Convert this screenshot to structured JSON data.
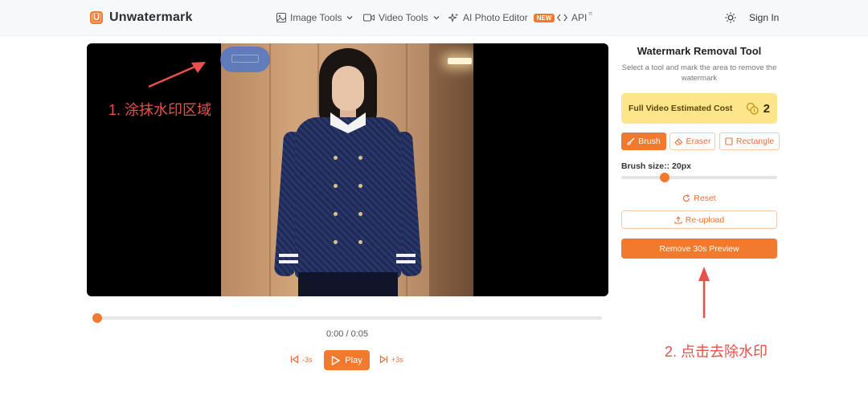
{
  "header": {
    "brand": "Unwatermark",
    "nav": {
      "image_tools": "Image Tools",
      "video_tools": "Video Tools",
      "ai_photo_editor": "AI Photo Editor",
      "new_badge": "NEW",
      "api": "API",
      "api_superscript": "π"
    },
    "sign_in": "Sign In"
  },
  "annotations": {
    "step1": "1. 涂抹水印区域",
    "step2": "2. 点击去除水印"
  },
  "player": {
    "time": "0:00 / 0:05",
    "progress": 0,
    "back_label": "-3s",
    "play_label": "Play",
    "forward_label": "+3s"
  },
  "panel": {
    "title": "Watermark Removal Tool",
    "description": "Select a tool and mark the area to remove the watermark",
    "cost_label": "Full Video Estimated Cost",
    "cost_value": "2",
    "tools": {
      "brush": "Brush",
      "eraser": "Eraser",
      "rectangle": "Rectangle"
    },
    "active_tool": "brush",
    "brush_size_label": "Brush size:: 20px",
    "brush_size_fraction": 0.28,
    "reset": "Reset",
    "reupload": "Re-upload",
    "remove": "Remove 30s Preview"
  },
  "colors": {
    "accent": "#f17a2f",
    "annotation": "#e8504b",
    "cost_bg": "#fde68a"
  },
  "icons": [
    "logo-icon",
    "image-icon",
    "chevron-down-icon",
    "video-icon",
    "sparkle-icon",
    "code-icon",
    "sun-icon",
    "skip-back-icon",
    "play-icon",
    "skip-forward-icon",
    "coins-icon",
    "brush-icon",
    "eraser-icon",
    "square-icon",
    "reset-icon",
    "upload-icon"
  ]
}
